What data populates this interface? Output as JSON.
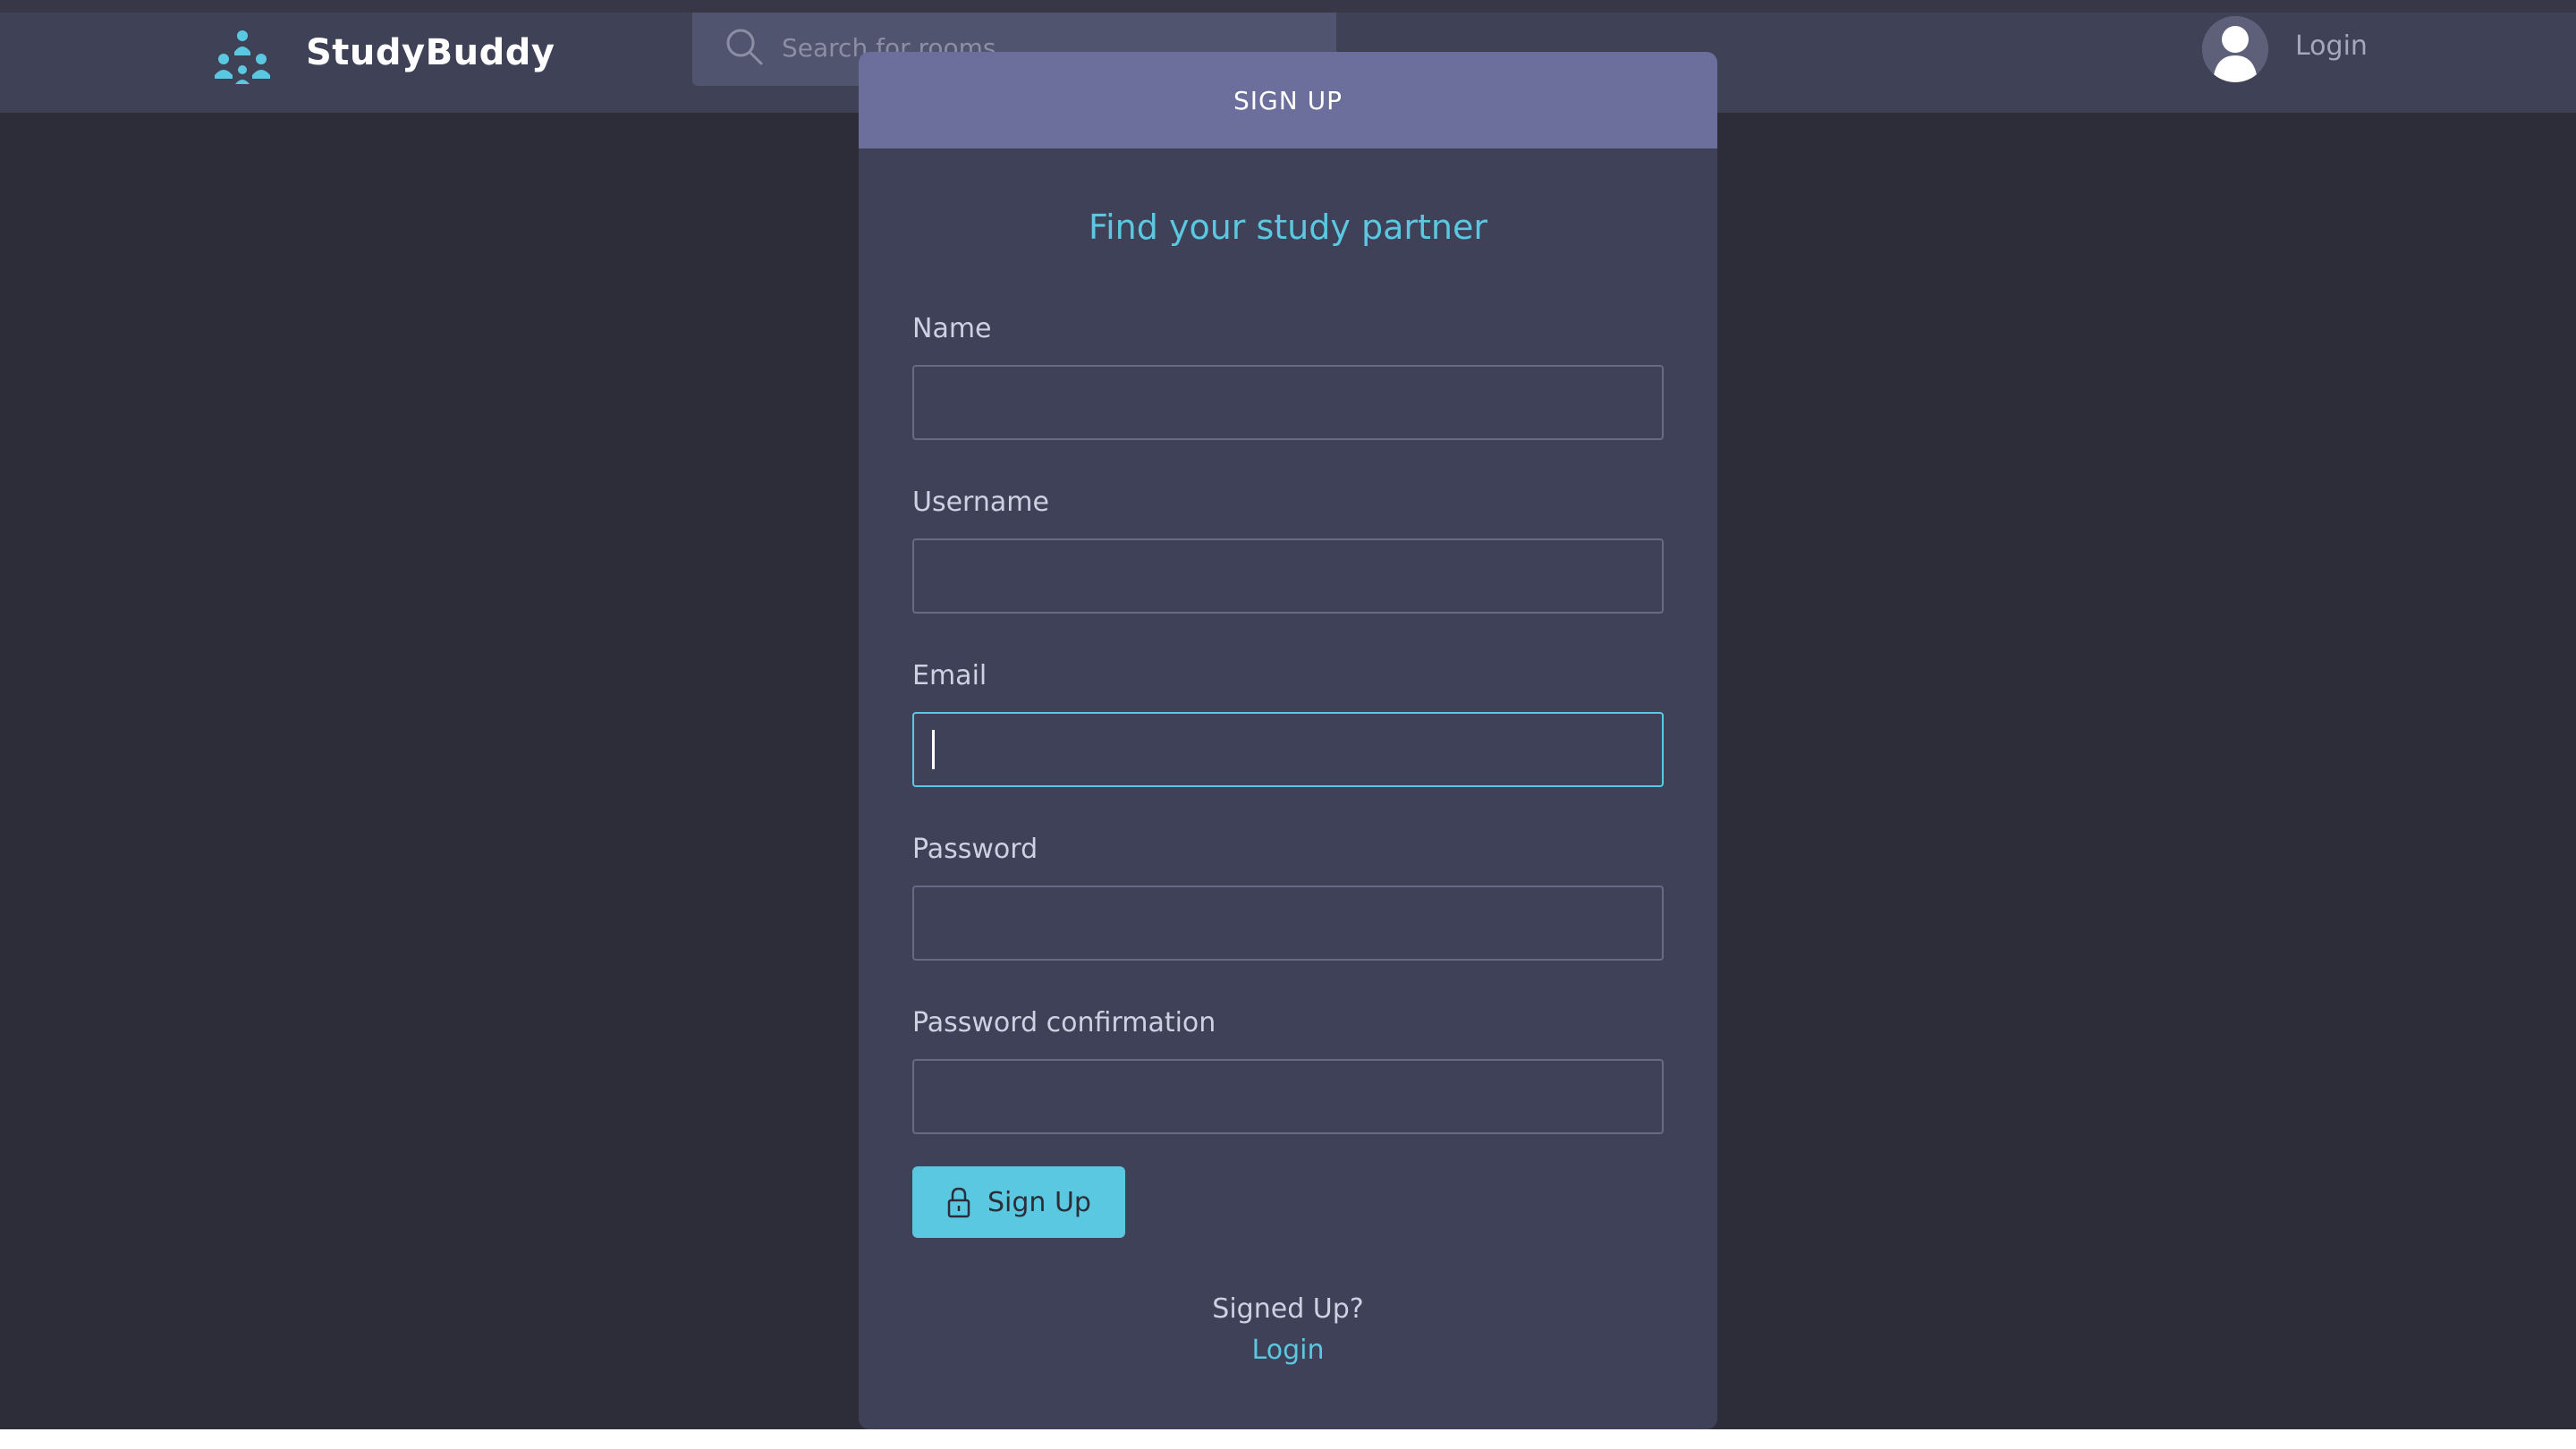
{
  "header": {
    "brand": "StudyBuddy",
    "logo_icon": "study-group-icon",
    "search": {
      "placeholder": "Search for rooms...",
      "value": "",
      "icon": "search-icon"
    },
    "user": {
      "avatar_icon": "avatar-icon",
      "login_label": "Login"
    }
  },
  "card": {
    "title": "SIGN UP",
    "subtitle": "Find your study partner",
    "fields": [
      {
        "label": "Name",
        "value": ""
      },
      {
        "label": "Username",
        "value": ""
      },
      {
        "label": "Email",
        "value": "",
        "focused": true
      },
      {
        "label": "Password",
        "value": ""
      },
      {
        "label": "Password confirmation",
        "value": ""
      }
    ],
    "submit": {
      "label": "Sign Up",
      "icon": "lock-icon"
    },
    "footer_text": "Signed Up?",
    "footer_link": "Login"
  },
  "colors": {
    "background": "#2d2d39",
    "header": "#3f4157",
    "card": "#3e4157",
    "card_header": "#6c6f9b",
    "accent": "#5ac8e0"
  }
}
